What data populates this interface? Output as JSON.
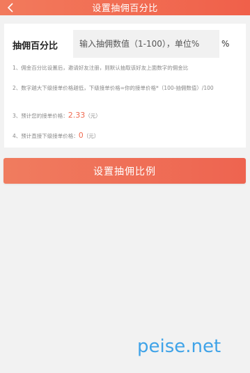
{
  "header": {
    "title": "设置抽佣百分比",
    "back_icon": "chevron-left-icon"
  },
  "form": {
    "label": "抽佣百分比",
    "input_placeholder": "输入抽佣数值（1-100），单位%",
    "unit": "%"
  },
  "notes": {
    "n1": "1、佣金百分比设置后，邀请好友注册，则默认抽取该好友上面数字的佣金比",
    "n2": "2、数字越大下级接单价格越低，下级接单价格=你的接单价格*（100-抽佣数值）/100",
    "n3_prefix": "3、预计您的接单价格：",
    "n3_value": "2.33",
    "n3_suffix": "（元）",
    "n4_prefix": "4、预计直接下级接单价格：",
    "n4_value": "0",
    "n4_suffix": "（元）"
  },
  "actions": {
    "submit_label": "设置抽佣比例"
  },
  "watermark": {
    "text": "peise.net"
  },
  "colors": {
    "accent": "#f06a50",
    "watermark": "#3fa3e8"
  }
}
